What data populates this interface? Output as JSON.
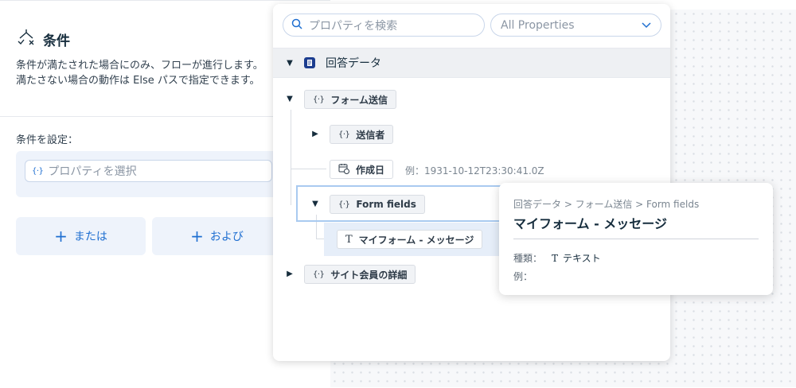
{
  "left": {
    "title": "条件",
    "description": "条件が満たされた場合にのみ、フローが進行します。満たさない場合の動作は Else パスで指定できます。",
    "condition_label": "条件を設定：",
    "property_placeholder": "プロパティを選択",
    "or_label": "または",
    "and_label": "および"
  },
  "picker": {
    "search_placeholder": "プロパティを検索",
    "filter_value": "All Properties",
    "root": "回答データ",
    "items": [
      {
        "label": "フォーム送信"
      },
      {
        "label": "送信者"
      },
      {
        "label": "作成日",
        "example": "例：1931-10-12T23:30:41.0Z"
      },
      {
        "label": "Form fields"
      },
      {
        "label": "マイフォーム - メッセージ"
      },
      {
        "label": "サイト会員の詳細"
      }
    ]
  },
  "tooltip": {
    "breadcrumb": "回答データ > フォーム送信 > Form fields",
    "title": "マイフォーム - メッセージ",
    "type_label": "種類：",
    "type_icon": "T",
    "type_value": "テキスト",
    "example_label": "例："
  },
  "colors": {
    "accent": "#1f6fd1",
    "root_icon": "#1c3d8f",
    "selection": "#a9caf0"
  }
}
